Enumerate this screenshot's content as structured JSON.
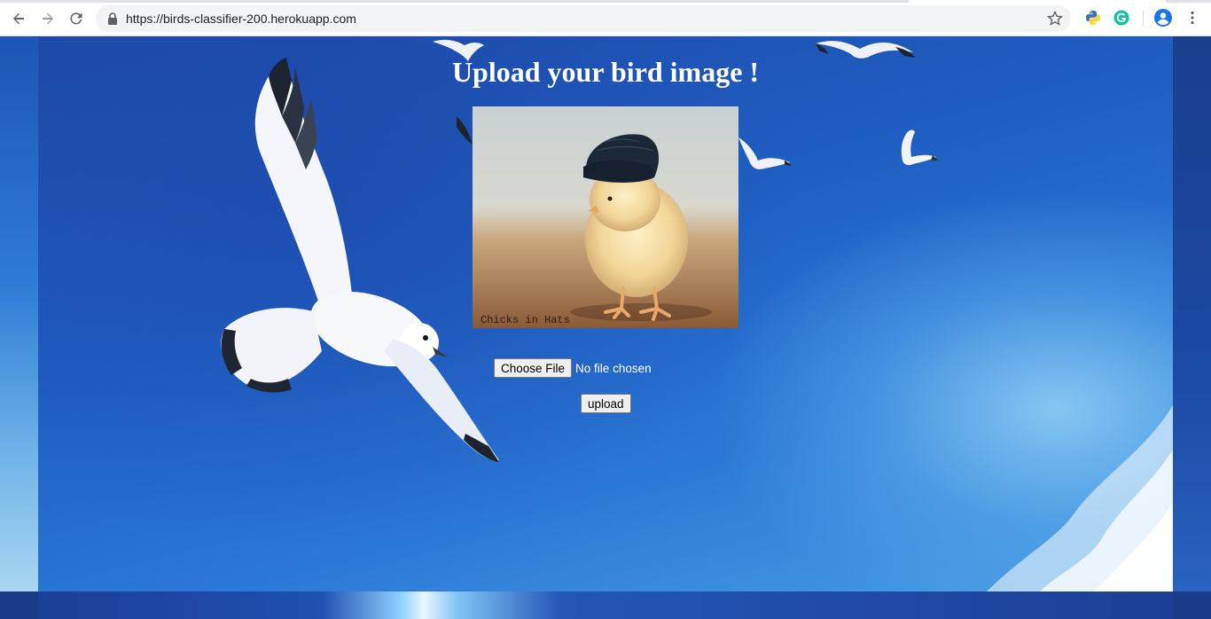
{
  "browser": {
    "url_host": "https://birds-classifier-200.herokuapp.com",
    "icons": [
      "back-icon",
      "forward-icon",
      "reload-icon",
      "lock-icon",
      "bookmark-star-icon",
      "python-extension-icon",
      "grammarly-extension-icon",
      "profile-avatar-icon",
      "more-menu-icon"
    ]
  },
  "page": {
    "heading": "Upload your bird image !",
    "preview_caption": "Chicks in Hats",
    "file_input": {
      "button_label": "Choose File",
      "status": "No file chosen"
    },
    "upload_label": "upload"
  },
  "colors": {
    "sky_blue": "#1f5fc3",
    "text_white": "#ffffff"
  }
}
